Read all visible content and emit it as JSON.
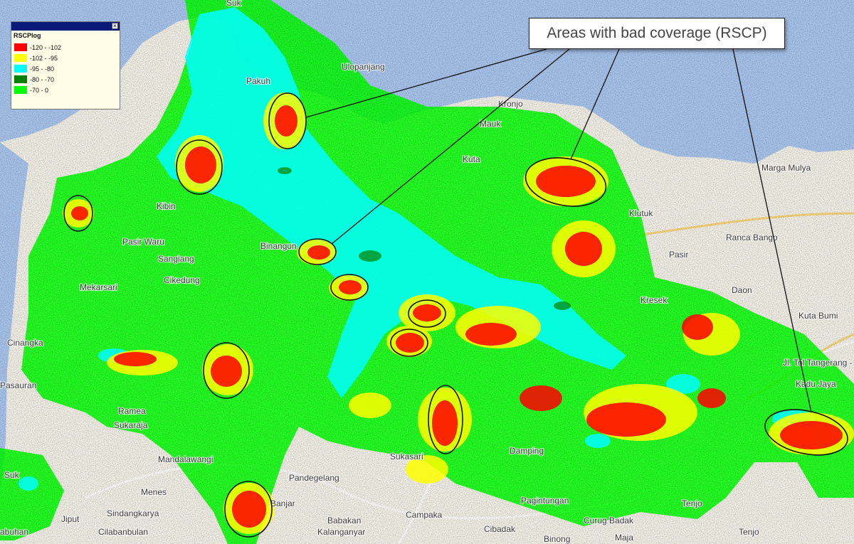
{
  "callout": {
    "text": "Areas with bad coverage (RSCP)"
  },
  "legend": {
    "title": "RSCPlog",
    "close_glyph": "×",
    "items": [
      {
        "range": "-120 - -102",
        "color": "#ff0000"
      },
      {
        "range": "-102 - -95",
        "color": "#ffff00"
      },
      {
        "range": "-95 - -80",
        "color": "#00ffff"
      },
      {
        "range": "-80 - -70",
        "color": "#008000"
      },
      {
        "range": "-70 - 0",
        "color": "#00ff00"
      }
    ]
  },
  "colors": {
    "sea": "#a8c4ec",
    "land": "#f2efe6",
    "coverage_red": "#ff0000",
    "coverage_yellow": "#ffff00",
    "coverage_cyan": "#00ffff",
    "coverage_dark_green": "#008000",
    "coverage_green": "#00ff00"
  },
  "places": {
    "sukabumi_top": "Suk",
    "ulopanjang": "Ulopanjang",
    "pakuhaji": "Pakuh",
    "kronjo": "Kronjo",
    "kibin": "Kibin",
    "pasir_wuru": "Pasir Waru",
    "sangiang": "Sangiang",
    "cikedung": "Cikedung",
    "binangun": "Binangun",
    "mekarsari": "Mekarsari",
    "cinangka": "Cinangka",
    "pasauran": "Pasauran",
    "ramea": "Ramea",
    "sukaraja": "Sukaraja",
    "mandalawangi": "Mandalawangi",
    "menes": "Menes",
    "sindangkarya": "Sindangkarya",
    "cilabanbulan": "Cilabanbulan",
    "labuhan": "abuhan",
    "jiput": "Jiput",
    "banjar": "Banjar",
    "pandegelang": "Pandegelang",
    "babakan": "Babakan",
    "kalanganyar": "Kalanganyar",
    "campaka": "Campaka",
    "cibadak": "Cibadak",
    "binong": "Binong",
    "sukasari": "Sukasari",
    "damping": "Damping",
    "pagintungan": "Pagintungan",
    "curug_badak": "Curug Badak",
    "maja": "Maja",
    "tenjo_1": "Tenjo",
    "tenjo_2": "Tenjo",
    "kadu_jaya": "Kadu Jaya",
    "kuta_bumi": "Kuta Bumi",
    "daon": "Daon",
    "pasir": "Pasir",
    "ranca_bango": "Ranca Bango",
    "klutuk": "Klutuk",
    "marga_mulya": "Marga Mulya",
    "tangerang_merak": "Jl. Tol Tangerang - Merak",
    "kresek": "Kresek",
    "mauk": "Mauk",
    "kuta": "Kuta",
    "suk_left": "Suk"
  }
}
